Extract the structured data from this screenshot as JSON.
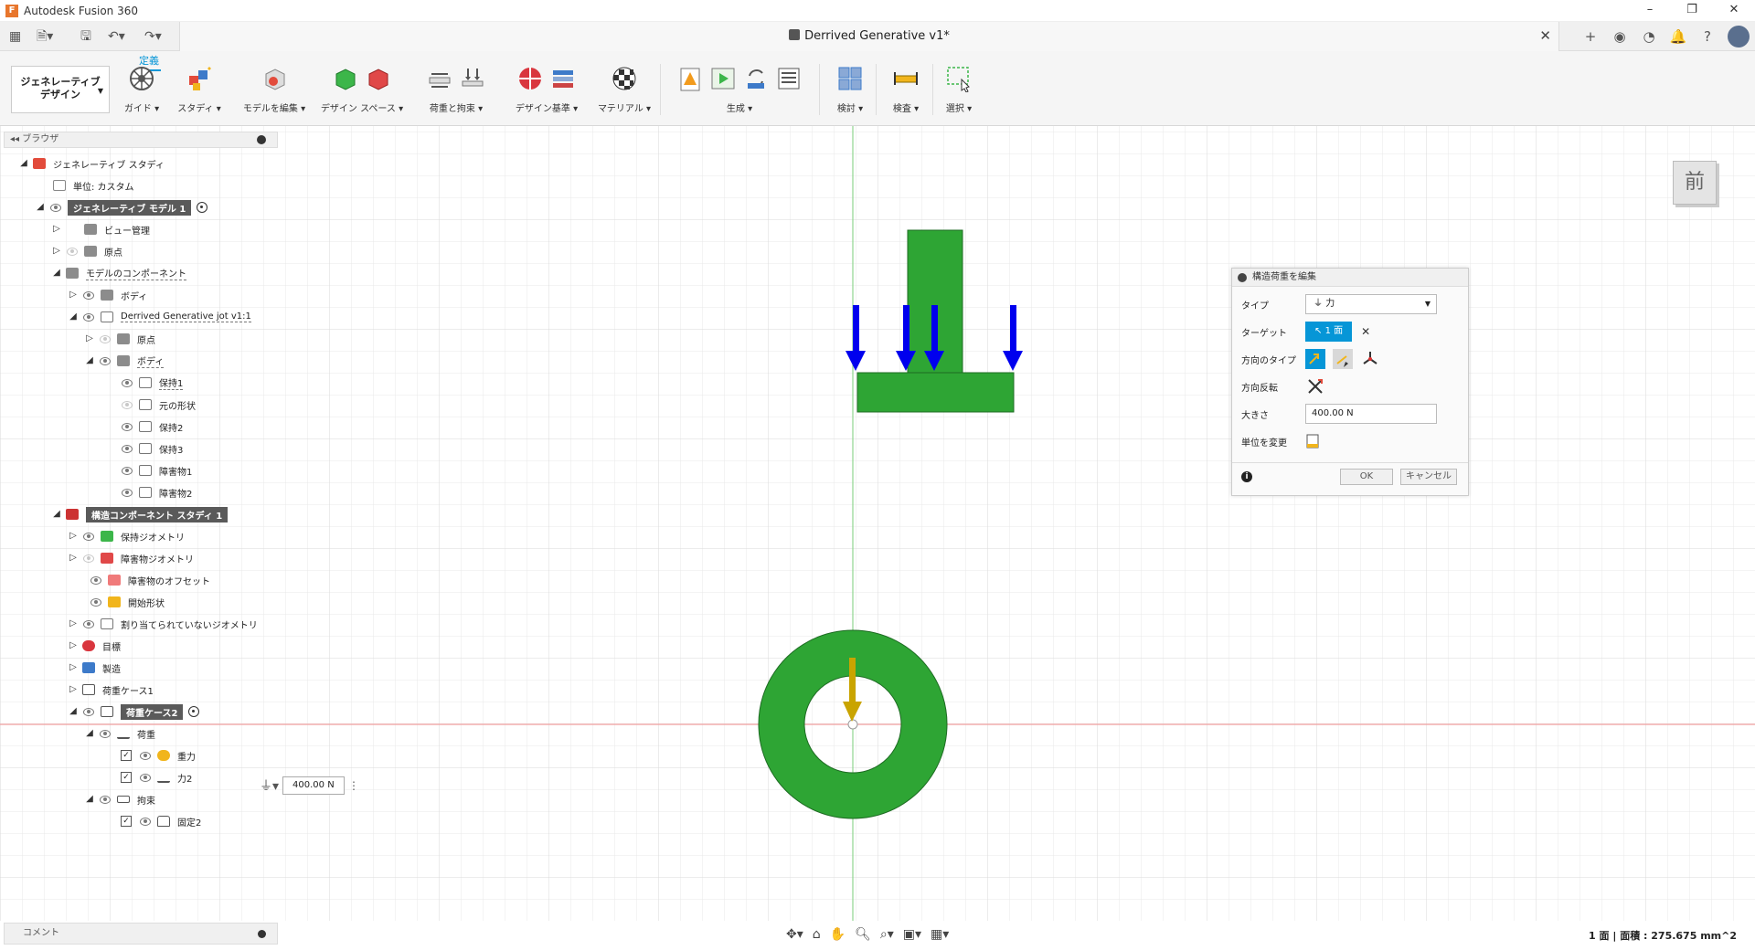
{
  "app": {
    "title": "Autodesk Fusion 360",
    "logo_letter": "F"
  },
  "window_controls": {
    "minimize": "–",
    "restore": "❐",
    "close": "✕"
  },
  "document": {
    "title": "Derrived Generative v1*",
    "close": "✕"
  },
  "ribbon": {
    "active_tab": "定義",
    "workspace": {
      "label_line1": "ジェネレーティブ",
      "label_line2": "デザイン"
    },
    "groups": [
      {
        "label": "ガイド ▾"
      },
      {
        "label": "スタディ ▾"
      },
      {
        "label": "モデルを編集 ▾"
      },
      {
        "label": "デザイン スペース ▾"
      },
      {
        "label": "荷重と拘束 ▾"
      },
      {
        "label": "デザイン基準 ▾"
      },
      {
        "label": "マテリアル ▾"
      },
      {
        "label": "生成 ▾"
      },
      {
        "label": "検討 ▾"
      },
      {
        "label": "検査 ▾"
      },
      {
        "label": "選択 ▾"
      }
    ]
  },
  "browser": {
    "header": "ブラウザ",
    "tree": [
      {
        "label": "ジェネレーティブ スタディ"
      },
      {
        "label": "単位: カスタム"
      },
      {
        "label": "ジェネレーティブ モデル 1"
      },
      {
        "label": "ビュー管理"
      },
      {
        "label": "原点"
      },
      {
        "label": "モデルのコンポーネント"
      },
      {
        "label": "ボディ"
      },
      {
        "label": "Derrived Generative jot v1:1"
      },
      {
        "label": "原点"
      },
      {
        "label": "ボディ"
      },
      {
        "label": "保持1"
      },
      {
        "label": "元の形状"
      },
      {
        "label": "保持2"
      },
      {
        "label": "保持3"
      },
      {
        "label": "障害物1"
      },
      {
        "label": "障害物2"
      },
      {
        "label": "構造コンポーネント スタディ 1"
      },
      {
        "label": "保持ジオメトリ"
      },
      {
        "label": "障害物ジオメトリ"
      },
      {
        "label": "障害物のオフセット"
      },
      {
        "label": "開始形状"
      },
      {
        "label": "割り当てられていないジオメトリ"
      },
      {
        "label": "目標"
      },
      {
        "label": "製造"
      },
      {
        "label": "荷重ケース1"
      },
      {
        "label": "荷重ケース2"
      },
      {
        "label": "荷重"
      },
      {
        "label": "重力"
      },
      {
        "label": "力2"
      },
      {
        "label": "拘束"
      },
      {
        "label": "固定2"
      }
    ]
  },
  "floating_input": {
    "value": "400.00 N"
  },
  "dialog": {
    "title": "構造荷重を編集",
    "type_label": "タイプ",
    "type_value": "力",
    "target_label": "ターゲット",
    "target_value": "1 面",
    "direction_type_label": "方向のタイプ",
    "flip_label": "方向反転",
    "magnitude_label": "大きさ",
    "magnitude_value": "400.00 N",
    "change_units_label": "単位を変更",
    "ok": "OK",
    "cancel": "キャンセル"
  },
  "comment_bar": {
    "label": "コメント"
  },
  "viewcube": {
    "face": "前"
  },
  "status": {
    "selection": "1 面 | 面積 : 275.675 mm^2"
  },
  "colors": {
    "accent": "#0696d7",
    "part_green": "#2ea534",
    "force_blue": "#0000ee",
    "gravity_gold": "#c9a400"
  }
}
